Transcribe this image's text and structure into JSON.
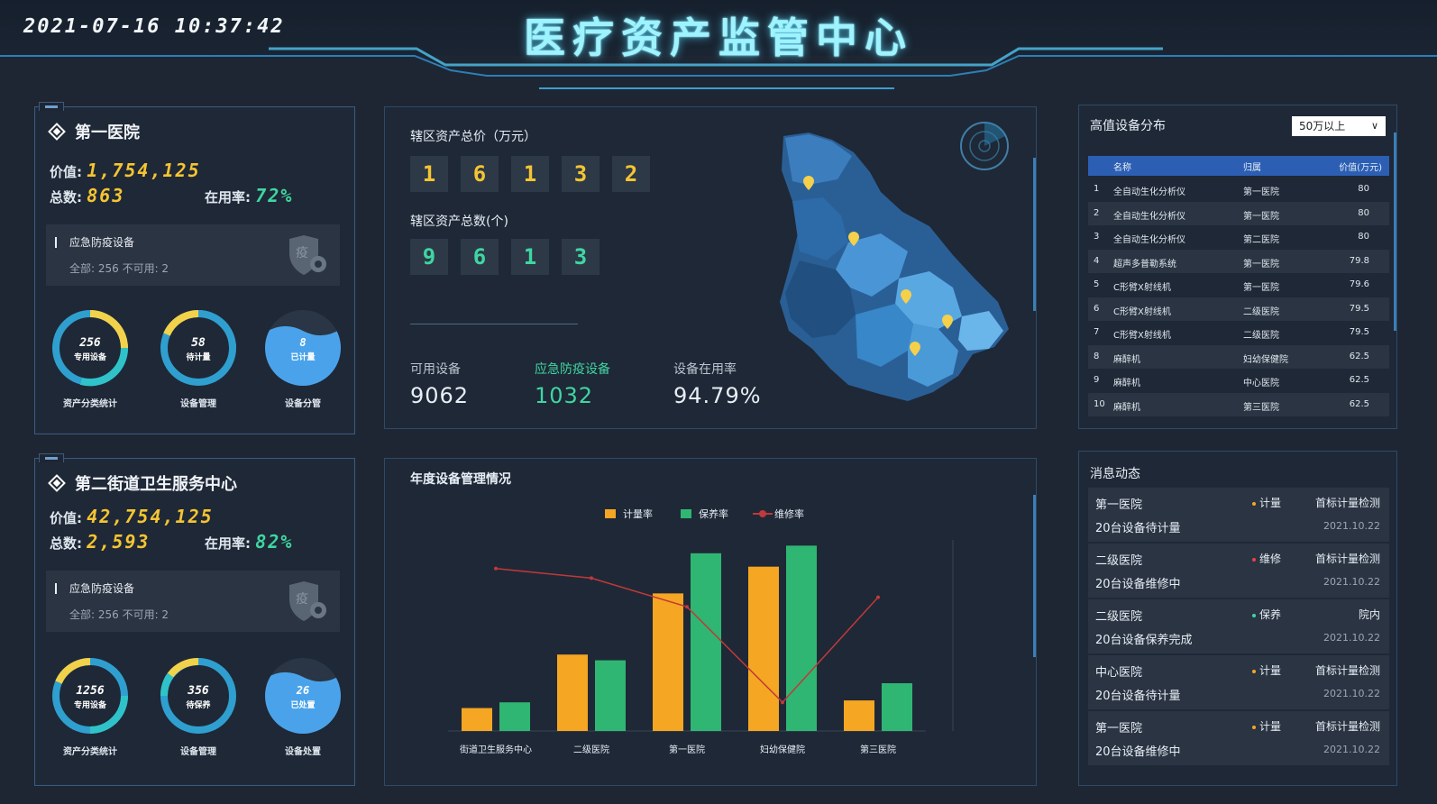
{
  "header": {
    "datetime": "2021-07-16  10:37:42",
    "title": "医疗资产监管中心"
  },
  "hospitals": [
    {
      "name": "第一医院",
      "value_label": "价值:",
      "value": "1,754,125",
      "total_label": "总数:",
      "total": "863",
      "usage_label": "在用率:",
      "usage": "72%",
      "emergency_title": "应急防疫设备",
      "emergency_sub": "全部: 256    不可用: 2",
      "rings": [
        {
          "value": "256",
          "sub": "专用设备",
          "label": "资产分类统计"
        },
        {
          "value": "58",
          "sub": "待计量",
          "label": "设备管理"
        },
        {
          "value": "8",
          "sub": "已计量",
          "label": "设备分管"
        }
      ]
    },
    {
      "name": "第二街道卫生服务中心",
      "value_label": "价值:",
      "value": "42,754,125",
      "total_label": "总数:",
      "total": "2,593",
      "usage_label": "在用率:",
      "usage": "82%",
      "emergency_title": "应急防疫设备",
      "emergency_sub": "全部: 256    不可用: 2",
      "rings": [
        {
          "value": "1256",
          "sub": "专用设备",
          "label": "资产分类统计"
        },
        {
          "value": "356",
          "sub": "待保养",
          "label": "设备管理"
        },
        {
          "value": "26",
          "sub": "已处置",
          "label": "设备处置"
        }
      ]
    }
  ],
  "overview": {
    "asset_total_title": "辖区资产总价（万元）",
    "asset_total_digits": [
      "1",
      "6",
      "1",
      "3",
      "2"
    ],
    "asset_count_title": "辖区资产总数(个)",
    "asset_count_digits": [
      "9",
      "6",
      "1",
      "3"
    ],
    "stats": [
      {
        "label": "可用设备",
        "value": "9062",
        "color": "#e6eef6"
      },
      {
        "label": "应急防疫设备",
        "value": "1032",
        "color": "#3fd6a2"
      },
      {
        "label": "设备在用率",
        "value": "94.79%",
        "color": "#e6eef6"
      }
    ]
  },
  "high_value": {
    "title": "高值设备分布",
    "filter": "50万以上",
    "columns": [
      "名称",
      "归属",
      "价值(万元)"
    ],
    "rows": [
      {
        "no": "1",
        "name": "全自动生化分析仪",
        "owner": "第一医院",
        "value": "80"
      },
      {
        "no": "2",
        "name": "全自动生化分析仪",
        "owner": "第一医院",
        "value": "80"
      },
      {
        "no": "3",
        "name": "全自动生化分析仪",
        "owner": "第二医院",
        "value": "80"
      },
      {
        "no": "4",
        "name": "超声多普勒系统",
        "owner": "第一医院",
        "value": "79.8"
      },
      {
        "no": "5",
        "name": "C形臂X射线机",
        "owner": "第一医院",
        "value": "79.6"
      },
      {
        "no": "6",
        "name": "C形臂X射线机",
        "owner": "二级医院",
        "value": "79.5"
      },
      {
        "no": "7",
        "name": "C形臂X射线机",
        "owner": "二级医院",
        "value": "79.5"
      },
      {
        "no": "8",
        "name": "麻醉机",
        "owner": "妇幼保健院",
        "value": "62.5"
      },
      {
        "no": "9",
        "name": "麻醉机",
        "owner": "中心医院",
        "value": "62.5"
      },
      {
        "no": "10",
        "name": "麻醉机",
        "owner": "第三医院",
        "value": "62.5"
      }
    ]
  },
  "messages": {
    "title": "消息动态",
    "items": [
      {
        "org": "第一医院",
        "type": "计量",
        "type_color": "#f5a623",
        "tag": "首标计量检测",
        "text": "20台设备待计量",
        "date": "2021.10.22"
      },
      {
        "org": "二级医院",
        "type": "维修",
        "type_color": "#e8424a",
        "tag": "首标计量检测",
        "text": "20台设备维修中",
        "date": "2021.10.22"
      },
      {
        "org": "二级医院",
        "type": "保养",
        "type_color": "#3fd6a2",
        "tag": "院内",
        "text": "20台设备保养完成",
        "date": "2021.10.22"
      },
      {
        "org": "中心医院",
        "type": "计量",
        "type_color": "#f5a623",
        "tag": "首标计量检测",
        "text": "20台设备待计量",
        "date": "2021.10.22"
      },
      {
        "org": "第一医院",
        "type": "计量",
        "type_color": "#f5a623",
        "tag": "首标计量检测",
        "text": "20台设备维修中",
        "date": "2021.10.22"
      }
    ]
  },
  "chart_data": {
    "type": "bar",
    "title": "年度设备管理情况",
    "categories": [
      "街道卫生服务中心",
      "二级医院",
      "第一医院",
      "妇幼保健院",
      "第三医院"
    ],
    "series": [
      {
        "name": "计量率",
        "kind": "bar",
        "color": "#f5a623",
        "values": [
          12,
          40,
          72,
          86,
          16
        ]
      },
      {
        "name": "保养率",
        "kind": "bar",
        "color": "#2fb673",
        "values": [
          15,
          37,
          93,
          97,
          25
        ]
      },
      {
        "name": "维修率",
        "kind": "line",
        "color": "#c0393b",
        "values": [
          85,
          80,
          65,
          15,
          70
        ]
      }
    ],
    "ylim": [
      0,
      100
    ]
  }
}
